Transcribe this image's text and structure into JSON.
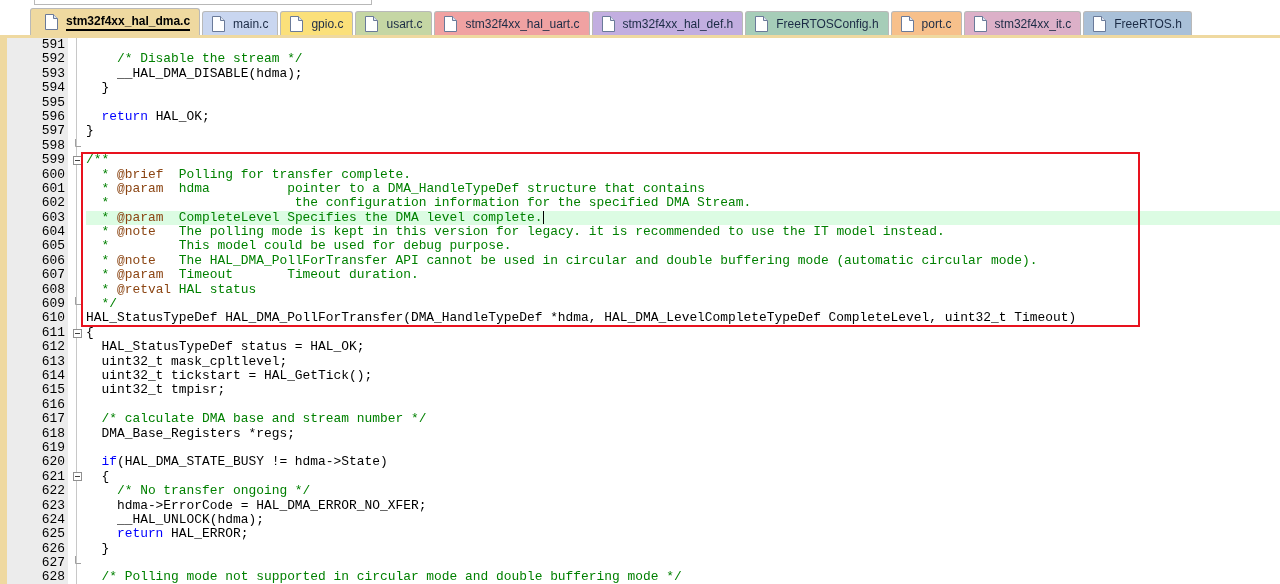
{
  "tabs": [
    {
      "label": "stm32f4xx_hal_dma.c",
      "selected": true,
      "color": "#efd9a0"
    },
    {
      "label": "main.c",
      "selected": false,
      "color": "#c9d6f0"
    },
    {
      "label": "gpio.c",
      "selected": false,
      "color": "#fbe07a"
    },
    {
      "label": "usart.c",
      "selected": false,
      "color": "#c5d6a4"
    },
    {
      "label": "stm32f4xx_hal_uart.c",
      "selected": false,
      "color": "#f0a2a2"
    },
    {
      "label": "stm32f4xx_hal_def.h",
      "selected": false,
      "color": "#c2aee0"
    },
    {
      "label": "FreeRTOSConfig.h",
      "selected": false,
      "color": "#a6cdb8"
    },
    {
      "label": "port.c",
      "selected": false,
      "color": "#f7c08b"
    },
    {
      "label": "stm32f4xx_it.c",
      "selected": false,
      "color": "#dcb0c8"
    },
    {
      "label": "FreeRTOS.h",
      "selected": false,
      "color": "#a9c0d8"
    }
  ],
  "editor": {
    "lines_before": [
      {
        "number": "591"
      },
      {
        "number": "592",
        "spans": [
          {
            "kind": "comment",
            "text": "    /* Disable the stream */"
          }
        ]
      },
      {
        "number": "593",
        "spans": [
          {
            "kind": "code",
            "text": "    __HAL_DMA_DISABLE(hdma);"
          }
        ]
      },
      {
        "number": "594",
        "spans": [
          {
            "kind": "code",
            "text": "  }"
          }
        ]
      },
      {
        "number": "595"
      },
      {
        "number": "596",
        "spans": [
          {
            "kind": "keyword",
            "text": "  return"
          },
          {
            "kind": "code",
            "text": " HAL_OK;"
          }
        ]
      },
      {
        "number": "597",
        "spans": [
          {
            "kind": "code",
            "text": "}"
          }
        ]
      },
      {
        "number": "598",
        "fold_end": true
      }
    ],
    "highlighted_block": [
      {
        "number": "599",
        "fold_start": true,
        "spans": [
          {
            "kind": "comment",
            "text": "/**"
          }
        ]
      },
      {
        "number": "600",
        "spans": [
          {
            "kind": "comment",
            "text": "  * "
          },
          {
            "kind": "doctag",
            "text": "@brief"
          },
          {
            "kind": "comment",
            "text": "  Polling for transfer complete."
          }
        ]
      },
      {
        "number": "601",
        "spans": [
          {
            "kind": "comment",
            "text": "  * "
          },
          {
            "kind": "doctag",
            "text": "@param"
          },
          {
            "kind": "comment",
            "text": "  hdma          pointer to a DMA_HandleTypeDef structure that contains"
          }
        ]
      },
      {
        "number": "602",
        "spans": [
          {
            "kind": "comment",
            "text": "  *                        the configuration information for the specified DMA Stream."
          }
        ]
      },
      {
        "number": "603",
        "current": true,
        "spans": [
          {
            "kind": "comment",
            "text": "  * "
          },
          {
            "kind": "doctag",
            "text": "@param"
          },
          {
            "kind": "comment",
            "text": "  CompleteLevel Specifies the DMA level complete."
          }
        ]
      },
      {
        "number": "604",
        "spans": [
          {
            "kind": "comment",
            "text": "  * "
          },
          {
            "kind": "doctag",
            "text": "@note"
          },
          {
            "kind": "comment",
            "text": "   The polling mode is kept in this version for legacy. it is recommended to use the IT model instead."
          }
        ]
      },
      {
        "number": "605",
        "spans": [
          {
            "kind": "comment",
            "text": "  *         This model could be used for debug purpose."
          }
        ]
      },
      {
        "number": "606",
        "spans": [
          {
            "kind": "comment",
            "text": "  * "
          },
          {
            "kind": "doctag",
            "text": "@note"
          },
          {
            "kind": "comment",
            "text": "   The HAL_DMA_PollForTransfer API cannot be used in circular and double buffering mode (automatic circular mode)."
          }
        ]
      },
      {
        "number": "607",
        "spans": [
          {
            "kind": "comment",
            "text": "  * "
          },
          {
            "kind": "doctag",
            "text": "@param"
          },
          {
            "kind": "comment",
            "text": "  Timeout       Timeout duration."
          }
        ]
      },
      {
        "number": "608",
        "spans": [
          {
            "kind": "comment",
            "text": "  * "
          },
          {
            "kind": "doctag",
            "text": "@retval"
          },
          {
            "kind": "comment",
            "text": " HAL status"
          }
        ]
      },
      {
        "number": "609",
        "fold_end": true,
        "spans": [
          {
            "kind": "comment",
            "text": "  */"
          }
        ]
      },
      {
        "number": "610",
        "spans": [
          {
            "kind": "code",
            "text": "HAL_StatusTypeDef HAL_DMA_PollForTransfer(DMA_HandleTypeDef *hdma, HAL_DMA_LevelCompleteTypeDef CompleteLevel, uint32_t Timeout)"
          }
        ]
      }
    ],
    "lines_after": [
      {
        "number": "611",
        "fold_start": true,
        "spans": [
          {
            "kind": "code",
            "text": "{"
          }
        ]
      },
      {
        "number": "612",
        "spans": [
          {
            "kind": "code",
            "text": "  HAL_StatusTypeDef status = HAL_OK;"
          }
        ]
      },
      {
        "number": "613",
        "spans": [
          {
            "kind": "code",
            "text": "  uint32_t mask_cpltlevel;"
          }
        ]
      },
      {
        "number": "614",
        "spans": [
          {
            "kind": "code",
            "text": "  uint32_t tickstart = HAL_GetTick();"
          }
        ]
      },
      {
        "number": "615",
        "spans": [
          {
            "kind": "code",
            "text": "  uint32_t tmpisr;"
          }
        ]
      },
      {
        "number": "616"
      },
      {
        "number": "617",
        "spans": [
          {
            "kind": "comment",
            "text": "  /* calculate DMA base and stream number */"
          }
        ]
      },
      {
        "number": "618",
        "spans": [
          {
            "kind": "code",
            "text": "  DMA_Base_Registers *regs;"
          }
        ]
      },
      {
        "number": "619"
      },
      {
        "number": "620",
        "spans": [
          {
            "kind": "keyword",
            "text": "  if"
          },
          {
            "kind": "code",
            "text": "(HAL_DMA_STATE_BUSY != hdma->State)"
          }
        ]
      },
      {
        "number": "621",
        "fold_start": true,
        "spans": [
          {
            "kind": "code",
            "text": "  {"
          }
        ]
      },
      {
        "number": "622",
        "spans": [
          {
            "kind": "comment",
            "text": "    /* No transfer ongoing */"
          }
        ]
      },
      {
        "number": "623",
        "spans": [
          {
            "kind": "code",
            "text": "    hdma->ErrorCode = HAL_DMA_ERROR_NO_XFER;"
          }
        ]
      },
      {
        "number": "624",
        "spans": [
          {
            "kind": "code",
            "text": "    __HAL_UNLOCK(hdma);"
          }
        ]
      },
      {
        "number": "625",
        "spans": [
          {
            "kind": "keyword",
            "text": "    return"
          },
          {
            "kind": "code",
            "text": " HAL_ERROR;"
          }
        ]
      },
      {
        "number": "626",
        "spans": [
          {
            "kind": "code",
            "text": "  }"
          }
        ]
      },
      {
        "number": "627",
        "fold_end": true
      },
      {
        "number": "628",
        "spans": [
          {
            "kind": "comment",
            "text": "  /* Polling mode not supported in circular mode and double buffering mode */"
          }
        ]
      }
    ]
  }
}
